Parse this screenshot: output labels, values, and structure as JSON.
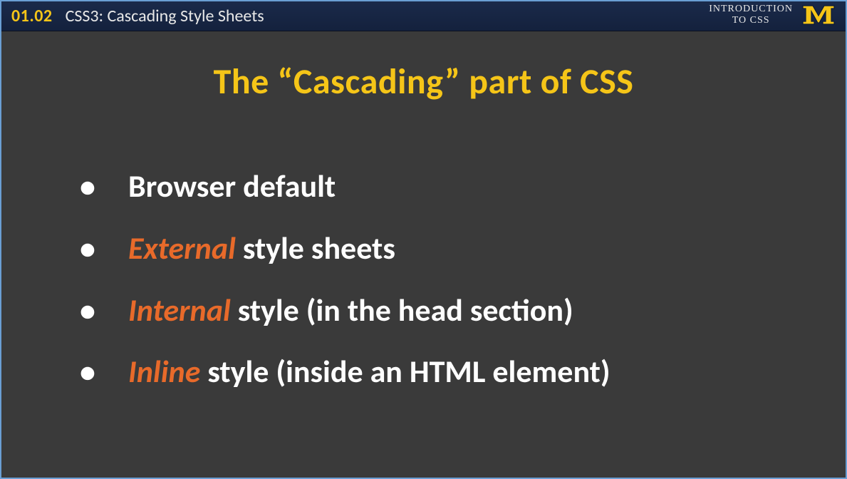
{
  "header": {
    "slide_number": "01.02",
    "title": "CSS3: Cascading Style Sheets",
    "course_line1": "INTRODUCTION",
    "course_line2": "TO CSS"
  },
  "slide": {
    "title": "The “Cascading” part of CSS",
    "bullets": [
      {
        "prefix": "",
        "em": "",
        "text": "Browser default"
      },
      {
        "prefix": "",
        "em": "External",
        "text": " style sheets"
      },
      {
        "prefix": "",
        "em": "Internal",
        "text": " style (in the head section)"
      },
      {
        "prefix": "",
        "em": "Inline",
        "text": " style (inside an HTML element)"
      }
    ]
  }
}
